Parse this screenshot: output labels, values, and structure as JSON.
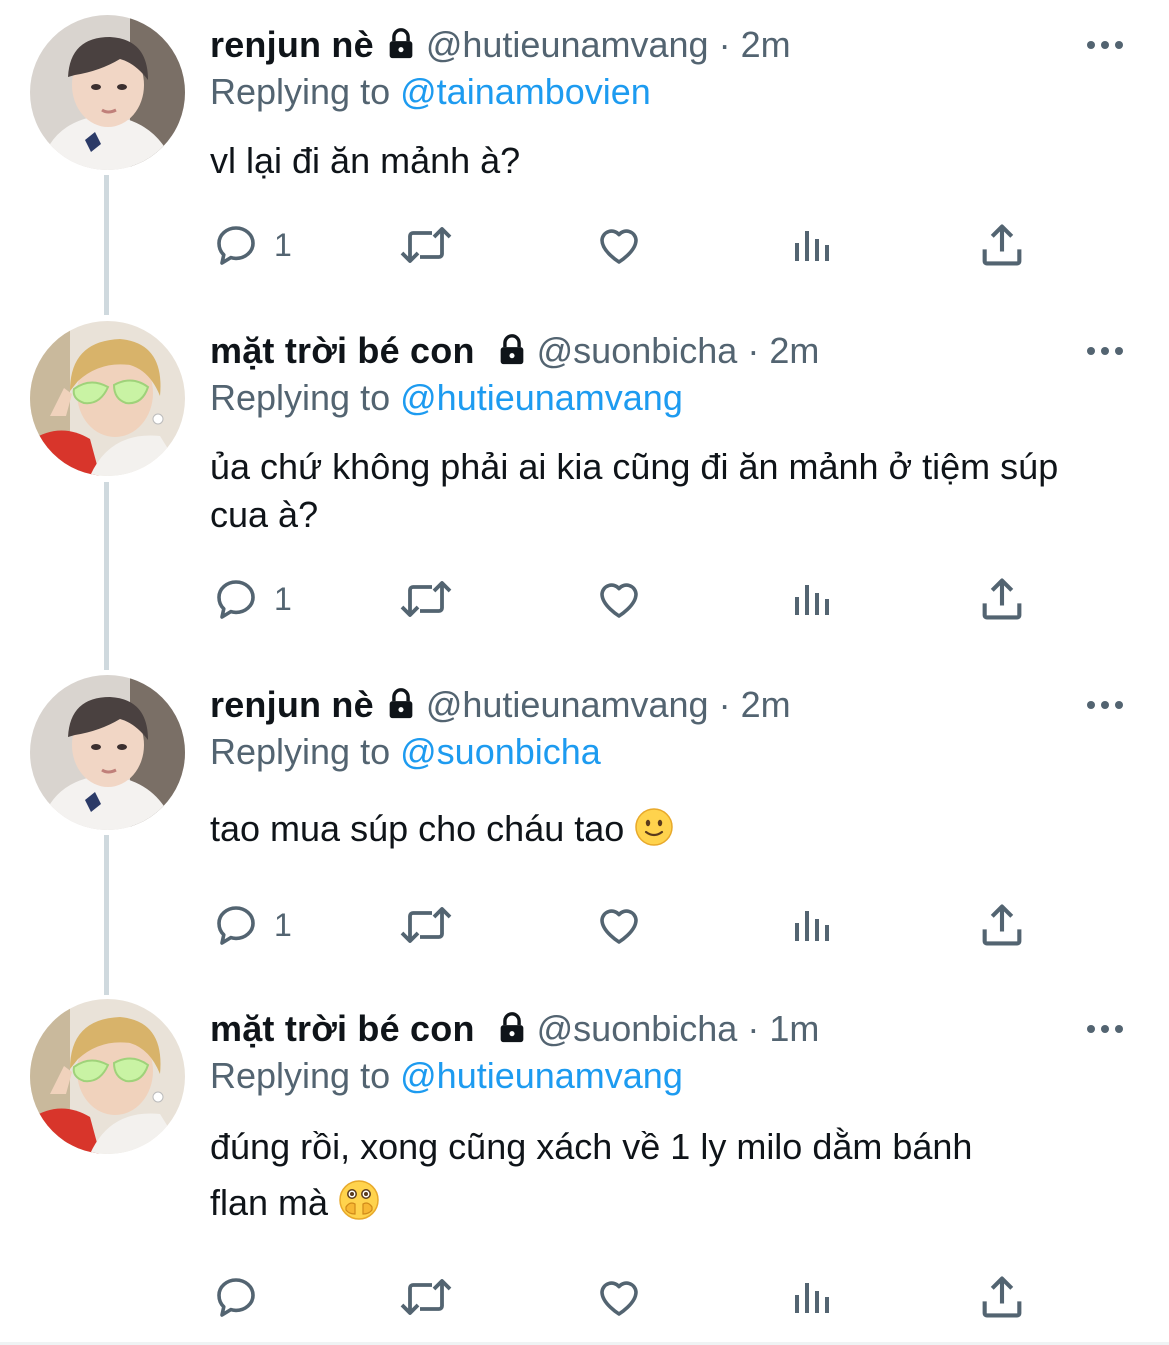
{
  "tweets": [
    {
      "name": "renjun nè",
      "handle": "@hutieunamvang",
      "sep": "·",
      "time": "2m",
      "replying_label": "Replying to",
      "replying_to": "@tainambovien",
      "text": "vl lại đi ăn mảnh à?",
      "reply_count": "1",
      "avatar": "renjun-avatar",
      "locked": true
    },
    {
      "name": "mặt trời bé con",
      "handle": "@suonbicha",
      "sep": "·",
      "time": "2m",
      "replying_label": "Replying to",
      "replying_to": "@hutieunamvang",
      "text": "ủa chứ không phải ai kia cũng đi ăn mảnh ở tiệm súp cua à?",
      "reply_count": "1",
      "avatar": "sun-avatar",
      "locked": true
    },
    {
      "name": "renjun nè",
      "handle": "@hutieunamvang",
      "sep": "·",
      "time": "2m",
      "replying_label": "Replying to",
      "replying_to": "@suonbicha",
      "text": "tao mua súp cho cháu tao",
      "emoji": "slightly-smiling-face",
      "reply_count": "1",
      "avatar": "renjun-avatar",
      "locked": true
    },
    {
      "name": "mặt trời bé con",
      "handle": "@suonbicha",
      "sep": "·",
      "time": "1m",
      "replying_label": "Replying to",
      "replying_to": "@hutieunamvang",
      "text_line1": "đúng rồi, xong cũng xách về 1 ly milo dằm bánh",
      "text_line2": "flan mà",
      "emoji": "face-with-open-eyes-and-hand-over-mouth",
      "reply_count": "",
      "avatar": "sun-avatar",
      "locked": true
    }
  ],
  "colors": {
    "text": "#0f1419",
    "secondary": "#536471",
    "link": "#1d9bf0",
    "thread_line": "#cfd9de"
  },
  "icons": [
    "reply-icon",
    "retweet-icon",
    "like-icon",
    "views-icon",
    "share-icon",
    "lock-icon",
    "more-icon"
  ]
}
